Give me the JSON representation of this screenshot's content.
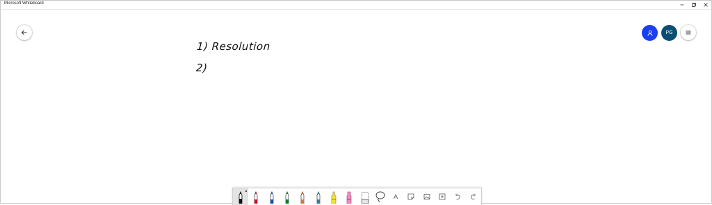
{
  "window": {
    "title": "Microsoft Whiteboard"
  },
  "header": {
    "back_icon": "arrow-left-icon",
    "invite_icon": "person-icon",
    "user_initials": "PG",
    "menu_icon": "hamburger-icon"
  },
  "canvas": {
    "lines": [
      "1) Resolution",
      "2)"
    ]
  },
  "toolbar": {
    "tools": [
      {
        "name": "pen-black",
        "color": "#111111",
        "selected": true
      },
      {
        "name": "pen-red",
        "color": "#c8102e"
      },
      {
        "name": "pen-blue",
        "color": "#1f4ea8"
      },
      {
        "name": "pen-green",
        "color": "#0e7a3a"
      },
      {
        "name": "pen-orange",
        "color": "#d9762b"
      },
      {
        "name": "pen-teal",
        "color": "#2f7fa0"
      },
      {
        "name": "highlighter-yellow",
        "color": "#f2e53a"
      },
      {
        "name": "highlighter-pink",
        "color": "#f28bc0"
      },
      {
        "name": "eraser",
        "color": "#888888"
      },
      {
        "name": "lasso",
        "color": "#333333"
      },
      {
        "name": "text",
        "color": "#555555"
      },
      {
        "name": "note",
        "color": "#555555"
      },
      {
        "name": "image",
        "color": "#555555"
      },
      {
        "name": "add",
        "color": "#555555"
      },
      {
        "name": "undo",
        "color": "#555555"
      },
      {
        "name": "redo",
        "color": "#555555"
      }
    ],
    "text_tool_label": "A"
  },
  "colors": {
    "invite_avatar": "#1a3ff2",
    "user_avatar": "#0b4e73"
  }
}
